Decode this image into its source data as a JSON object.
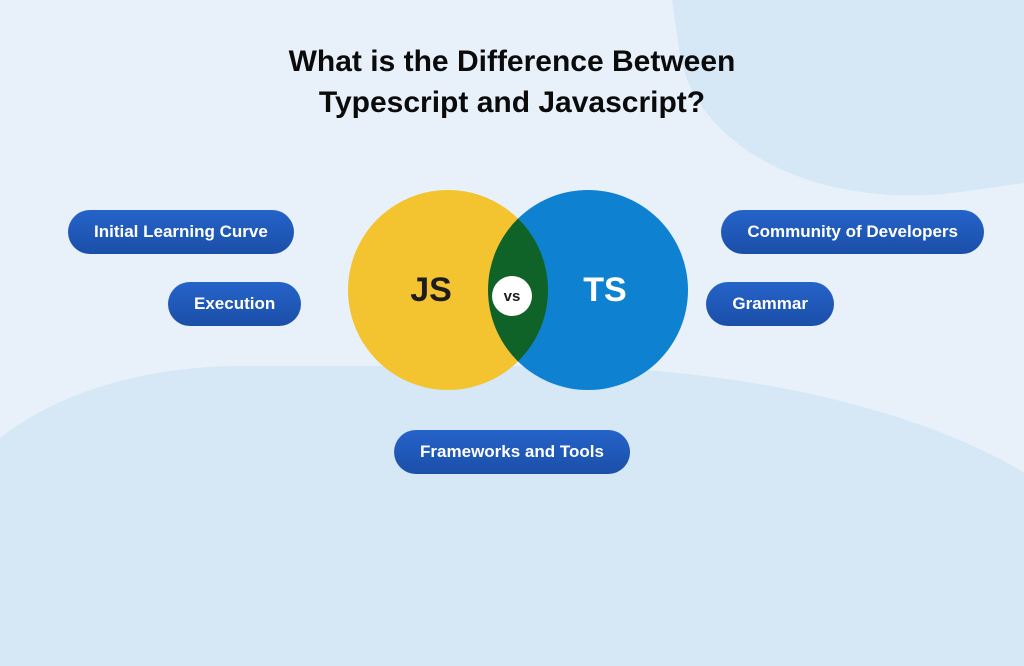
{
  "title_line1": "What is the Difference Between",
  "title_line2": "Typescript and Javascript?",
  "venn": {
    "left_label": "JS",
    "right_label": "TS",
    "vs_label": "vs"
  },
  "pills": {
    "learning": "Initial Learning Curve",
    "execution": "Execution",
    "community": "Community of Developers",
    "grammar": "Grammar",
    "frameworks": "Frameworks and Tools"
  },
  "colors": {
    "js_circle": "#f4c430",
    "ts_circle": "#0f81d1",
    "pill_bg": "#1b4fa8",
    "page_bg": "#e8f1fa"
  }
}
